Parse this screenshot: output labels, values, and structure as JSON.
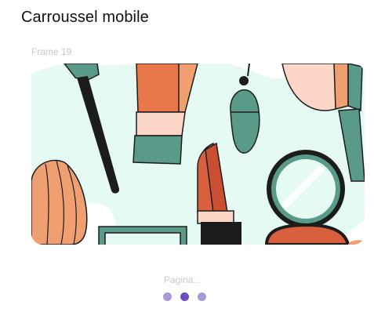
{
  "page": {
    "title": "Carroussel mobile"
  },
  "frame": {
    "label": "Frame 19"
  },
  "carousel": {
    "illustration": "cosmetics-illustration",
    "colors": {
      "background": "#e6faf4",
      "teal": "#5a9a8a",
      "orange": "#f0a070",
      "coral": "#e0704a",
      "peach": "#fcd6c6",
      "dark": "#1c1c1c"
    }
  },
  "pagination": {
    "label": "Pagina...",
    "total": 3,
    "active_index": 1,
    "colors": {
      "inactive": "#a898d4",
      "active": "#6a4ec0"
    }
  }
}
